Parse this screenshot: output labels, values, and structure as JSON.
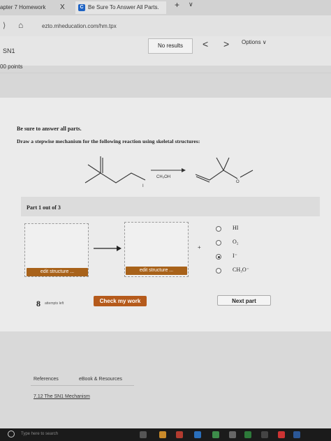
{
  "browser": {
    "tabs": [
      {
        "label": "apter 7 Homework",
        "close": "X"
      },
      {
        "label": "Be Sure To Answer All Parts.",
        "icon": "C"
      }
    ],
    "new_tab": "+",
    "tab_menu": "∨",
    "back": "⟩",
    "home": "⌂",
    "url": "ezto.mheducation.com/hm.tpx"
  },
  "app": {
    "find_results": "No results",
    "prev": "<",
    "next": ">",
    "options": "Options ∨",
    "title": "SN1",
    "points": "00 points"
  },
  "question": {
    "intro": "Be sure to answer all parts.",
    "prompt": "Draw a stepwise mechanism for the following reaction using skeletal structures:",
    "reagent": "CH₃OH",
    "leaving_group": "I",
    "product_atom": "O",
    "part_label": "Part 1 out of 3",
    "edit_structure": "edit structure ...",
    "plus": "+",
    "options": [
      "HI",
      "O₂",
      "I⁻",
      "CH₃O⁻"
    ],
    "selected_option": 2
  },
  "actions": {
    "attempts_number": "8",
    "attempts_label": "attempts left",
    "check": "Check my work",
    "next_part": "Next part"
  },
  "footer": {
    "references": "References",
    "ebook": "eBook & Resources",
    "link": "7.12 The SN1 Mechanism",
    "search_placeholder": "Type here to search"
  }
}
